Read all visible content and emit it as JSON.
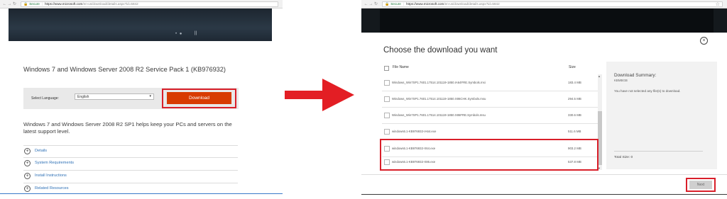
{
  "before": {
    "browser": {
      "nav_icons": [
        "back-icon",
        "forward-icon",
        "reload-icon"
      ],
      "secure_label": "Secure",
      "url_host": "https://www.microsoft.com",
      "url_path": "/en-us/download/details.aspx?id=5842"
    },
    "hero": {
      "dots": "• ●",
      "pause": "||"
    },
    "page_title": "Windows 7 and Windows Server 2008 R2 Service Pack 1 (KB976932)",
    "language": {
      "label": "Select Language:",
      "value": "English"
    },
    "download_button": "Download",
    "description": "Windows 7 and Windows Server 2008 R2 SP1 helps keep your PCs and servers on the latest support level.",
    "sections": [
      {
        "label": "Details"
      },
      {
        "label": "System Requirements"
      },
      {
        "label": "Install Instructions"
      },
      {
        "label": "Related Resources"
      }
    ]
  },
  "after": {
    "browser": {
      "secure_label": "Secure",
      "url_host": "https://www.microsoft.com",
      "url_path": "/en-us/download/details.aspx?id=5842"
    },
    "dialog_title": "Choose the download you want",
    "columns": {
      "file_name": "File Name",
      "size": "Size"
    },
    "files": [
      {
        "name": "Windows_Win7SP1.7601.17514.101119-1850.IA64FRE.Symbols.msi",
        "size": "183.4 MB"
      },
      {
        "name": "Windows_Win7SP1.7601.17514.101119-1850.X86CHK.Symbols.msu",
        "size": "294.5 MB"
      },
      {
        "name": "Windows_Win7SP1.7601.17514.101119-1850.X86FRE.Symbols.msu",
        "size": "330.6 MB"
      },
      {
        "name": "windows6.1-KB976932-IA64.exe",
        "size": "511.6 MB"
      },
      {
        "name": "windows6.1-KB976932-X64.exe",
        "size": "903.2 MB"
      },
      {
        "name": "windows6.1-KB976932-X86.exe",
        "size": "537.8 MB"
      }
    ],
    "summary": {
      "title": "Download Summary:",
      "kb": "KBMBGB",
      "message": "You have not selected any file(s) to download.",
      "total": "Total Size: 0"
    },
    "next_button": "Next"
  },
  "colors": {
    "download_red": "#d83b01",
    "highlight_red": "#d91f2a",
    "link_blue": "#2f71b6",
    "arrow_red": "#e31e24"
  }
}
